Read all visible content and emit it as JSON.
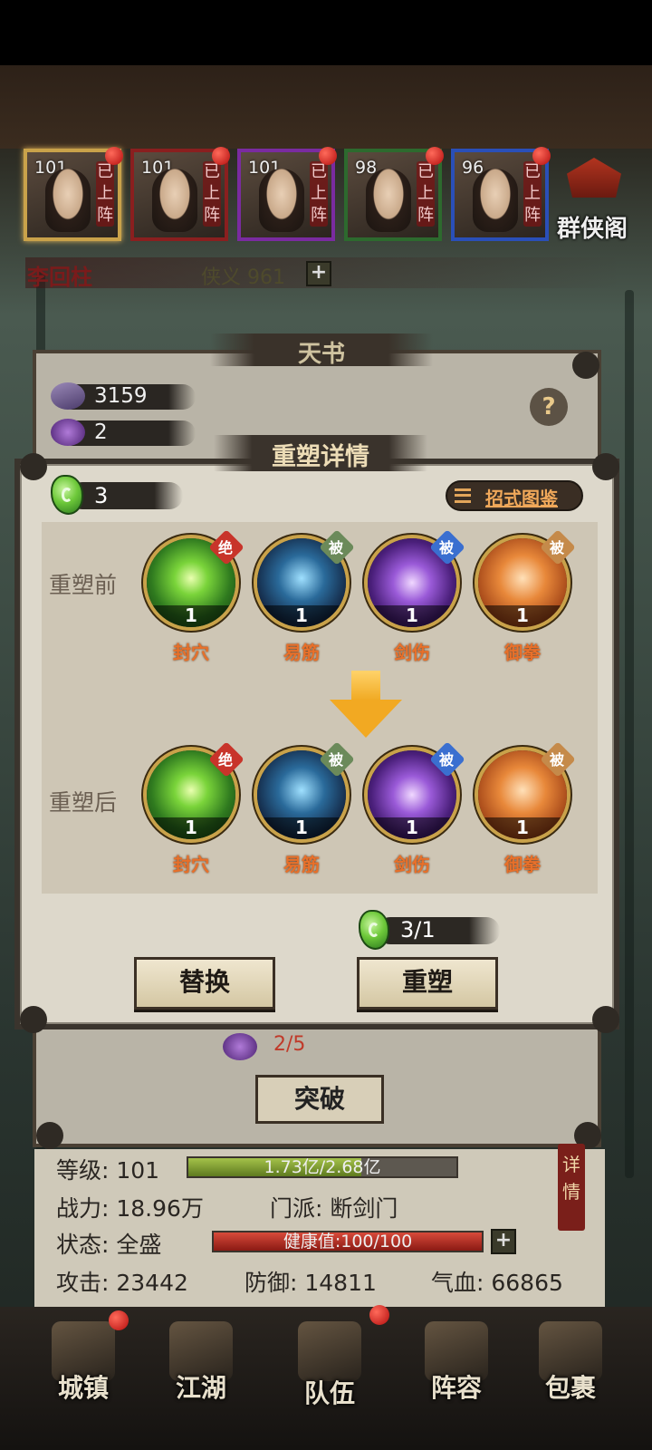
{
  "heroes": [
    {
      "level": "101",
      "tag": "已上阵",
      "frame": "sel"
    },
    {
      "level": "101",
      "tag": "已上阵",
      "frame": "red"
    },
    {
      "level": "101",
      "tag": "已上阵",
      "frame": "purple"
    },
    {
      "level": "98",
      "tag": "已上阵",
      "frame": "green"
    },
    {
      "level": "96",
      "tag": "已上阵",
      "frame": "blue"
    }
  ],
  "hall_label": "群侠阁",
  "hero_name": "李回柱",
  "xiayi": "侠义 961",
  "back_panel": {
    "title": "天书",
    "res1": "3159",
    "res2": "2",
    "res3": "2/5",
    "help": "?",
    "tupo": "突破"
  },
  "modal": {
    "title": "重塑详情",
    "jade_count": "3",
    "guide_label": "招式图鉴",
    "before_label": "重塑前",
    "after_label": "重塑后",
    "before_skills": [
      {
        "name": "封穴",
        "level": "1",
        "badge": "绝",
        "badge_color": "#c8342a",
        "theme": "green"
      },
      {
        "name": "易筋",
        "level": "1",
        "badge": "被",
        "badge_color": "#6b8a5a",
        "theme": "blue"
      },
      {
        "name": "剑伤",
        "level": "1",
        "badge": "被",
        "badge_color": "#3a6fd0",
        "theme": "purple"
      },
      {
        "name": "御拳",
        "level": "1",
        "badge": "被",
        "badge_color": "#c58a4a",
        "theme": "orange"
      }
    ],
    "after_skills": [
      {
        "name": "封穴",
        "level": "1",
        "badge": "绝",
        "badge_color": "#c8342a",
        "theme": "green"
      },
      {
        "name": "易筋",
        "level": "1",
        "badge": "被",
        "badge_color": "#6b8a5a",
        "theme": "blue"
      },
      {
        "name": "剑伤",
        "level": "1",
        "badge": "被",
        "badge_color": "#3a6fd0",
        "theme": "purple"
      },
      {
        "name": "御拳",
        "level": "1",
        "badge": "被",
        "badge_color": "#c58a4a",
        "theme": "orange"
      }
    ],
    "cost": "3/1",
    "replace_label": "替换",
    "reshape_label": "重塑"
  },
  "stats": {
    "level_label": "等级: 101",
    "exp_text": "1.73亿/2.68亿",
    "exp_fraction": 0.645,
    "power": "战力: 18.96万",
    "sect": "门派: 断剑门",
    "state": "状态: 全盛",
    "health_text": "健康值:100/100",
    "health_fraction": 1.0,
    "attack": "攻击: 23442",
    "defense": "防御: 14811",
    "hp": "气血: 66865",
    "detail_tag": "详情"
  },
  "nav": [
    {
      "label": "城镇",
      "dot": true
    },
    {
      "label": "江湖",
      "dot": false
    },
    {
      "label": "队伍",
      "dot": true
    },
    {
      "label": "阵容",
      "dot": false
    },
    {
      "label": "包裹",
      "dot": false
    }
  ]
}
